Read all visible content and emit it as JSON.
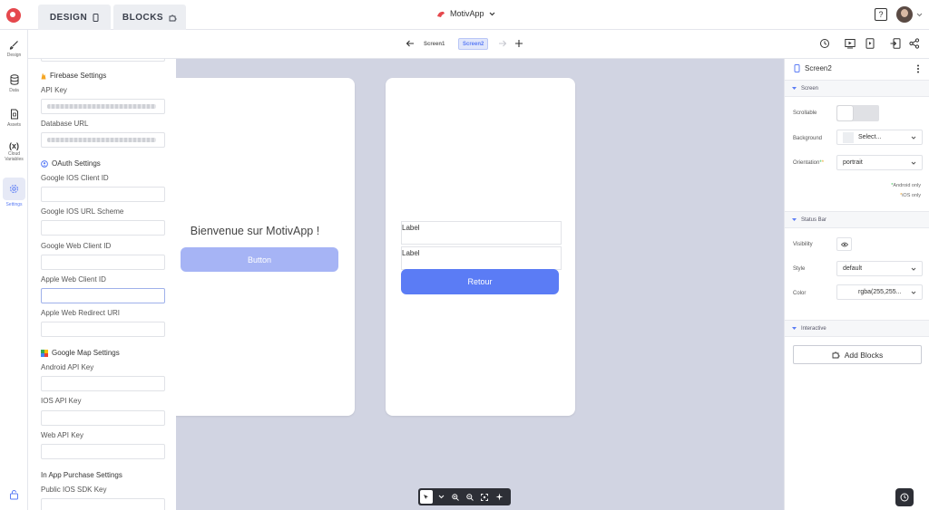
{
  "topbar": {
    "design_tab": "DESIGN",
    "blocks_tab": "BLOCKS",
    "app_name": "MotivApp",
    "help_label": "?"
  },
  "leftnav": [
    {
      "label": "Design",
      "icon": "brush-icon"
    },
    {
      "label": "Data",
      "icon": "database-icon"
    },
    {
      "label": "Assets",
      "icon": "file-icon"
    },
    {
      "label": "Cloud Variables",
      "icon": "variable-icon",
      "glyph": "(x)"
    },
    {
      "label": "Settings",
      "icon": "gear-icon"
    }
  ],
  "settings": {
    "firebase_title": "Firebase Settings",
    "api_key_label": "API Key",
    "database_url_label": "Database URL",
    "oauth_title": "OAuth Settings",
    "google_ios_client_label": "Google IOS Client ID",
    "google_ios_url_label": "Google IOS URL Scheme",
    "google_web_client_label": "Google Web Client ID",
    "apple_web_client_label": "Apple Web Client ID",
    "apple_web_redirect_label": "Apple Web Redirect URI",
    "google_map_title": "Google Map Settings",
    "android_api_label": "Android API Key",
    "ios_api_label": "IOS API Key",
    "web_api_label": "Web API Key",
    "iap_title": "In App Purchase Settings",
    "public_ios_sdk_label": "Public IOS SDK Key"
  },
  "screens": {
    "screen1": "Screen1",
    "screen2": "Screen2"
  },
  "canvas": {
    "welcome_text": "Bienvenue sur MotivApp !",
    "button_label": "Button",
    "label1": "Label",
    "label2": "Label",
    "back_button": "Retour"
  },
  "rightpanel": {
    "screen_name": "Screen2",
    "screen_section": "Screen",
    "scrollable_label": "Scrollable",
    "background_label": "Background",
    "background_value": "Select...",
    "orientation_label": "Orientation",
    "orientation_value": "portrait",
    "android_only": "Android only",
    "ios_only": "iOS only",
    "status_bar_section": "Status Bar",
    "visibility_label": "Visibility",
    "style_label": "Style",
    "style_value": "default",
    "color_label": "Color",
    "color_value": "rgba(255,255...",
    "interactive_section": "Interactive",
    "add_blocks": "Add Blocks"
  },
  "colors": {
    "accent": "#5b7cf5",
    "accent_light": "#a6b4f5",
    "canvas_bg": "#d1d4e2",
    "brand_red": "#e5484d",
    "android_dot": "#2fbf4a",
    "ios_dot": "#f0a020"
  }
}
